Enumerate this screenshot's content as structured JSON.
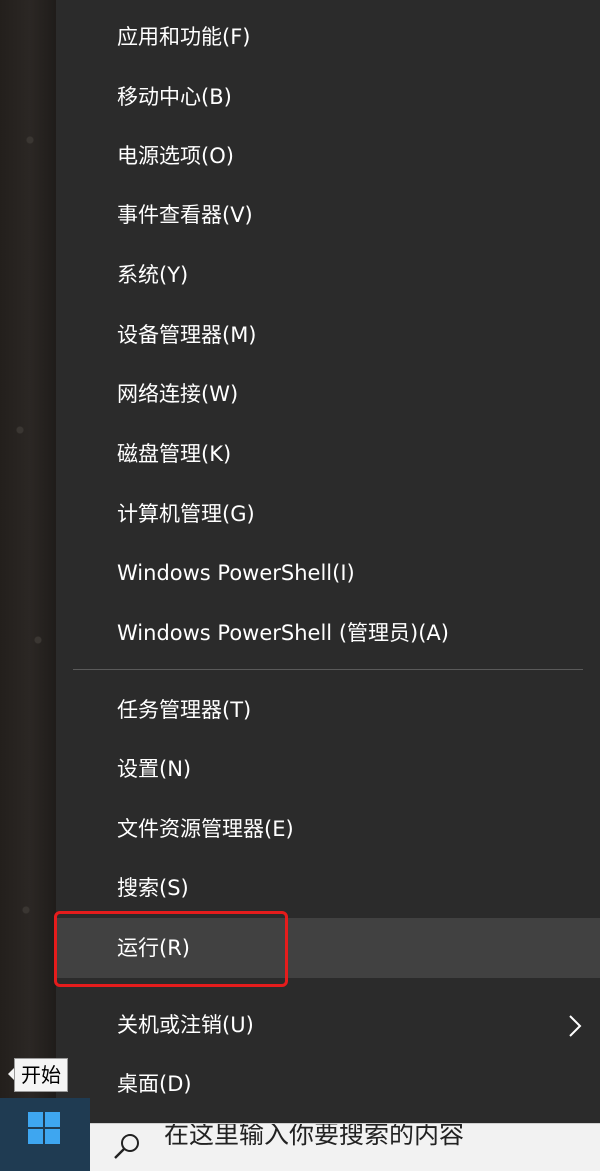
{
  "menu": {
    "items": [
      {
        "label": "应用和功能(F)"
      },
      {
        "label": "移动中心(B)"
      },
      {
        "label": "电源选项(O)"
      },
      {
        "label": "事件查看器(V)"
      },
      {
        "label": "系统(Y)"
      },
      {
        "label": "设备管理器(M)"
      },
      {
        "label": "网络连接(W)"
      },
      {
        "label": "磁盘管理(K)"
      },
      {
        "label": "计算机管理(G)"
      },
      {
        "label": "Windows PowerShell(I)"
      },
      {
        "label": "Windows PowerShell (管理员)(A)"
      },
      {
        "label": "任务管理器(T)"
      },
      {
        "label": "设置(N)"
      },
      {
        "label": "文件资源管理器(E)"
      },
      {
        "label": "搜索(S)"
      },
      {
        "label": "运行(R)"
      },
      {
        "label": "关机或注销(U)",
        "submenu_icon": "chevron-right-icon"
      },
      {
        "label": "桌面(D)"
      }
    ],
    "hovered_item": "运行(R)",
    "highlight_color": "#e51c1c"
  },
  "taskbar": {
    "start_icon": "windows-logo-icon",
    "start_tooltip": "开始",
    "search_icon": "search-icon",
    "search_placeholder": "在这里输入你要搜索的内容"
  }
}
